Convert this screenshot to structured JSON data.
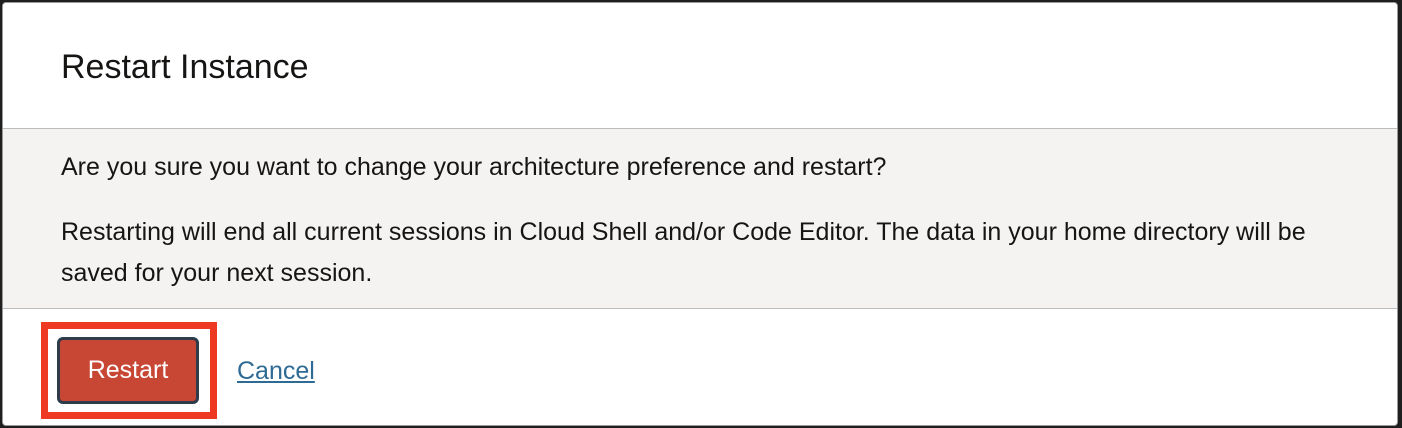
{
  "dialog": {
    "title": "Restart Instance",
    "question": "Are you sure you want to change your architecture preference and restart?",
    "description": "Restarting will end all current sessions in Cloud Shell and/or Code Editor. The data in your home directory will be saved for your next session.",
    "buttons": {
      "restart_label": "Restart",
      "cancel_label": "Cancel"
    }
  },
  "colors": {
    "primary_button": "#c74634",
    "highlight_frame": "#ee3a22",
    "link": "#2e6b94",
    "body_background": "#f4f3f1"
  }
}
